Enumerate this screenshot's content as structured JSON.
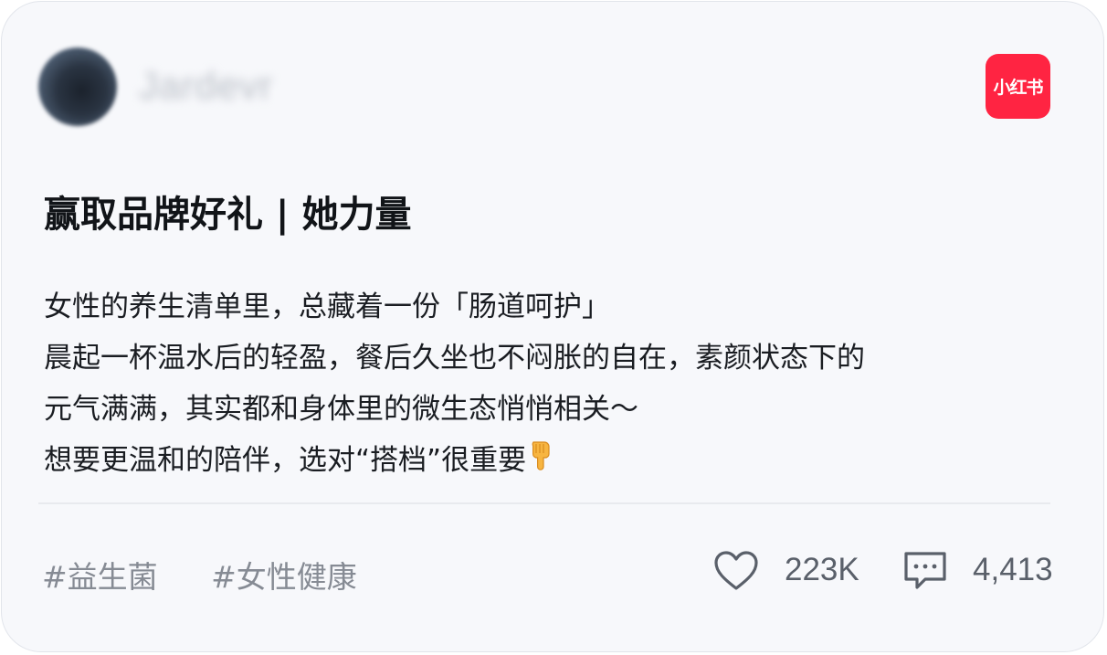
{
  "post": {
    "author_name": "Jardevr",
    "brand_logo_text": "小红书",
    "title": "赢取品牌好礼 | 她力量",
    "body_lines": [
      "女性的养生清单里，总藏着一份「肠道呵护」",
      "晨起一杯温水后的轻盈，餐后久坐也不闷胀的自在，素颜状态下的",
      "元气满满，其实都和身体里的微生态悄悄相关～",
      "想要更温和的陪伴，选对“搭档”很重要"
    ],
    "body_end_icon": "pointing-down-hand-icon",
    "tags": [
      "#益生菌",
      "#女性健康"
    ],
    "likes": "223K",
    "comments": "4,413"
  },
  "colors": {
    "brand_red": "#ff2442",
    "card_background": "#f7f8fb",
    "tag_text": "#868b94",
    "stat_text": "#5a606a"
  },
  "icons": {
    "like": "heart-icon",
    "comment": "comment-bubble-icon"
  }
}
